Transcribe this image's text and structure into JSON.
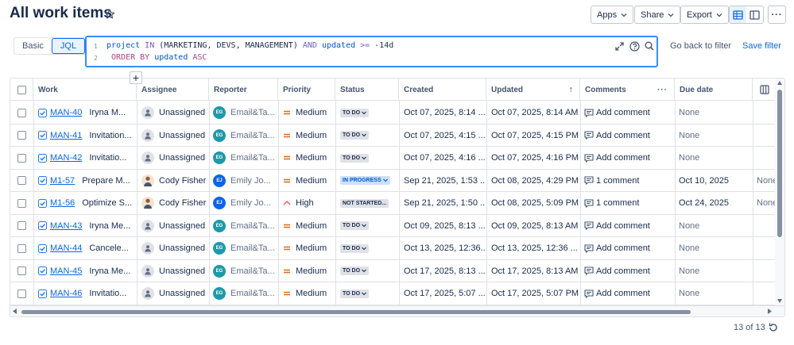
{
  "page_title": "All work items",
  "toolbar": {
    "apps_label": "Apps",
    "share_label": "Share",
    "export_label": "Export",
    "more_label": "···"
  },
  "search_modes": [
    "Basic",
    "JQL"
  ],
  "active_mode": "JQL",
  "jql": {
    "line1_no": "1",
    "line2_no": "2",
    "l1_field": "project",
    "l1_op": " IN ",
    "l1_values": "(MARKETING, DEVS, MANAGEMENT) ",
    "l1_and": "AND",
    "l1_field2": " updated",
    "l1_cmp": " >=",
    "l1_val": " -14d",
    "l2_order": " ORDER BY",
    "l2_field": " updated",
    "l2_dir": " ASC"
  },
  "go_back_label": "Go back to filter",
  "save_filter_label": "Save filter",
  "add_column_label": "+",
  "columns": [
    "Work",
    "Assignee",
    "Reporter",
    "Priority",
    "Status",
    "Created",
    "Updated",
    "Comments",
    "Due date"
  ],
  "sort_indicator": "↑",
  "rows": [
    {
      "key": "MAN-40",
      "summary": "Iryna M...",
      "assignee": "Unassigned",
      "assignee_type": "none",
      "reporter": "Email&Ta...",
      "reporter_initials": "EG",
      "priority": "Medium",
      "status": "TO DO",
      "created": "Oct 07, 2025, 8:14 ...",
      "updated": "Oct 07, 2025, 8:14 AM",
      "comments": "Add comment",
      "due": "None",
      "extra": ""
    },
    {
      "key": "MAN-41",
      "summary": "Invitation...",
      "assignee": "Unassigned",
      "assignee_type": "none",
      "reporter": "Email&Ta...",
      "reporter_initials": "EG",
      "priority": "Medium",
      "status": "TO DO",
      "created": "Oct 07, 2025, 4:15 ...",
      "updated": "Oct 07, 2025, 4:15 PM",
      "comments": "Add comment",
      "due": "None",
      "extra": ""
    },
    {
      "key": "MAN-42",
      "summary": "Invitatio...",
      "assignee": "Unassigned",
      "assignee_type": "none",
      "reporter": "Email&Ta...",
      "reporter_initials": "EG",
      "priority": "Medium",
      "status": "TO DO",
      "created": "Oct 07, 2025, 4:16 ...",
      "updated": "Oct 07, 2025, 4:16 PM",
      "comments": "Add comment",
      "due": "None",
      "extra": ""
    },
    {
      "key": "M1-57",
      "summary": "Prepare M...",
      "assignee": "Cody Fisher",
      "assignee_type": "person",
      "reporter": "Emily Jo...",
      "reporter_initials": "EJ",
      "priority": "Medium",
      "status": "IN PROGRESS",
      "created": "Sep 21, 2025, 1:53 ...",
      "updated": "Oct 08, 2025, 4:29 PM",
      "comments": "1 comment",
      "due": "Oct 10, 2025",
      "extra": "None"
    },
    {
      "key": "M1-56",
      "summary": "Optimize S...",
      "assignee": "Cody Fisher",
      "assignee_type": "person",
      "reporter": "Emily Jo...",
      "reporter_initials": "EJ",
      "priority": "High",
      "status": "NOT STARTED...",
      "created": "Sep 21, 2025, 1:50 ...",
      "updated": "Oct 08, 2025, 5:09 PM",
      "comments": "1 comment",
      "due": "Oct 24, 2025",
      "extra": "None"
    },
    {
      "key": "MAN-43",
      "summary": "Iryna Me...",
      "assignee": "Unassigned",
      "assignee_type": "none",
      "reporter": "Email&Ta...",
      "reporter_initials": "EG",
      "priority": "Medium",
      "status": "TO DO",
      "created": "Oct 09, 2025, 8:13 ...",
      "updated": "Oct 09, 2025, 8:13 AM",
      "comments": "Add comment",
      "due": "None",
      "extra": ""
    },
    {
      "key": "MAN-44",
      "summary": "Cancele...",
      "assignee": "Unassigned",
      "assignee_type": "none",
      "reporter": "Email&Ta...",
      "reporter_initials": "EG",
      "priority": "Medium",
      "status": "TO DO",
      "created": "Oct 13, 2025, 12:36...",
      "updated": "Oct 13, 2025, 12:36 ...",
      "comments": "Add comment",
      "due": "None",
      "extra": ""
    },
    {
      "key": "MAN-45",
      "summary": "Iryna Me...",
      "assignee": "Unassigned",
      "assignee_type": "none",
      "reporter": "Email&Ta...",
      "reporter_initials": "EG",
      "priority": "Medium",
      "status": "TO DO",
      "created": "Oct 17, 2025, 8:13 ...",
      "updated": "Oct 17, 2025, 8:13 AM",
      "comments": "Add comment",
      "due": "None",
      "extra": ""
    },
    {
      "key": "MAN-46",
      "summary": "Invitatio...",
      "assignee": "Unassigned",
      "assignee_type": "none",
      "reporter": "Email&Ta...",
      "reporter_initials": "EG",
      "priority": "Medium",
      "status": "TO DO",
      "created": "Oct 17, 2025, 5:07 ...",
      "updated": "Oct 17, 2025, 5:07 PM",
      "comments": "Add comment",
      "due": "None",
      "extra": ""
    }
  ],
  "pagination": "13 of 13",
  "colors": {
    "accent": "#0c66e4",
    "medium_priority": "#e56910",
    "high_priority": "#f15b50"
  }
}
